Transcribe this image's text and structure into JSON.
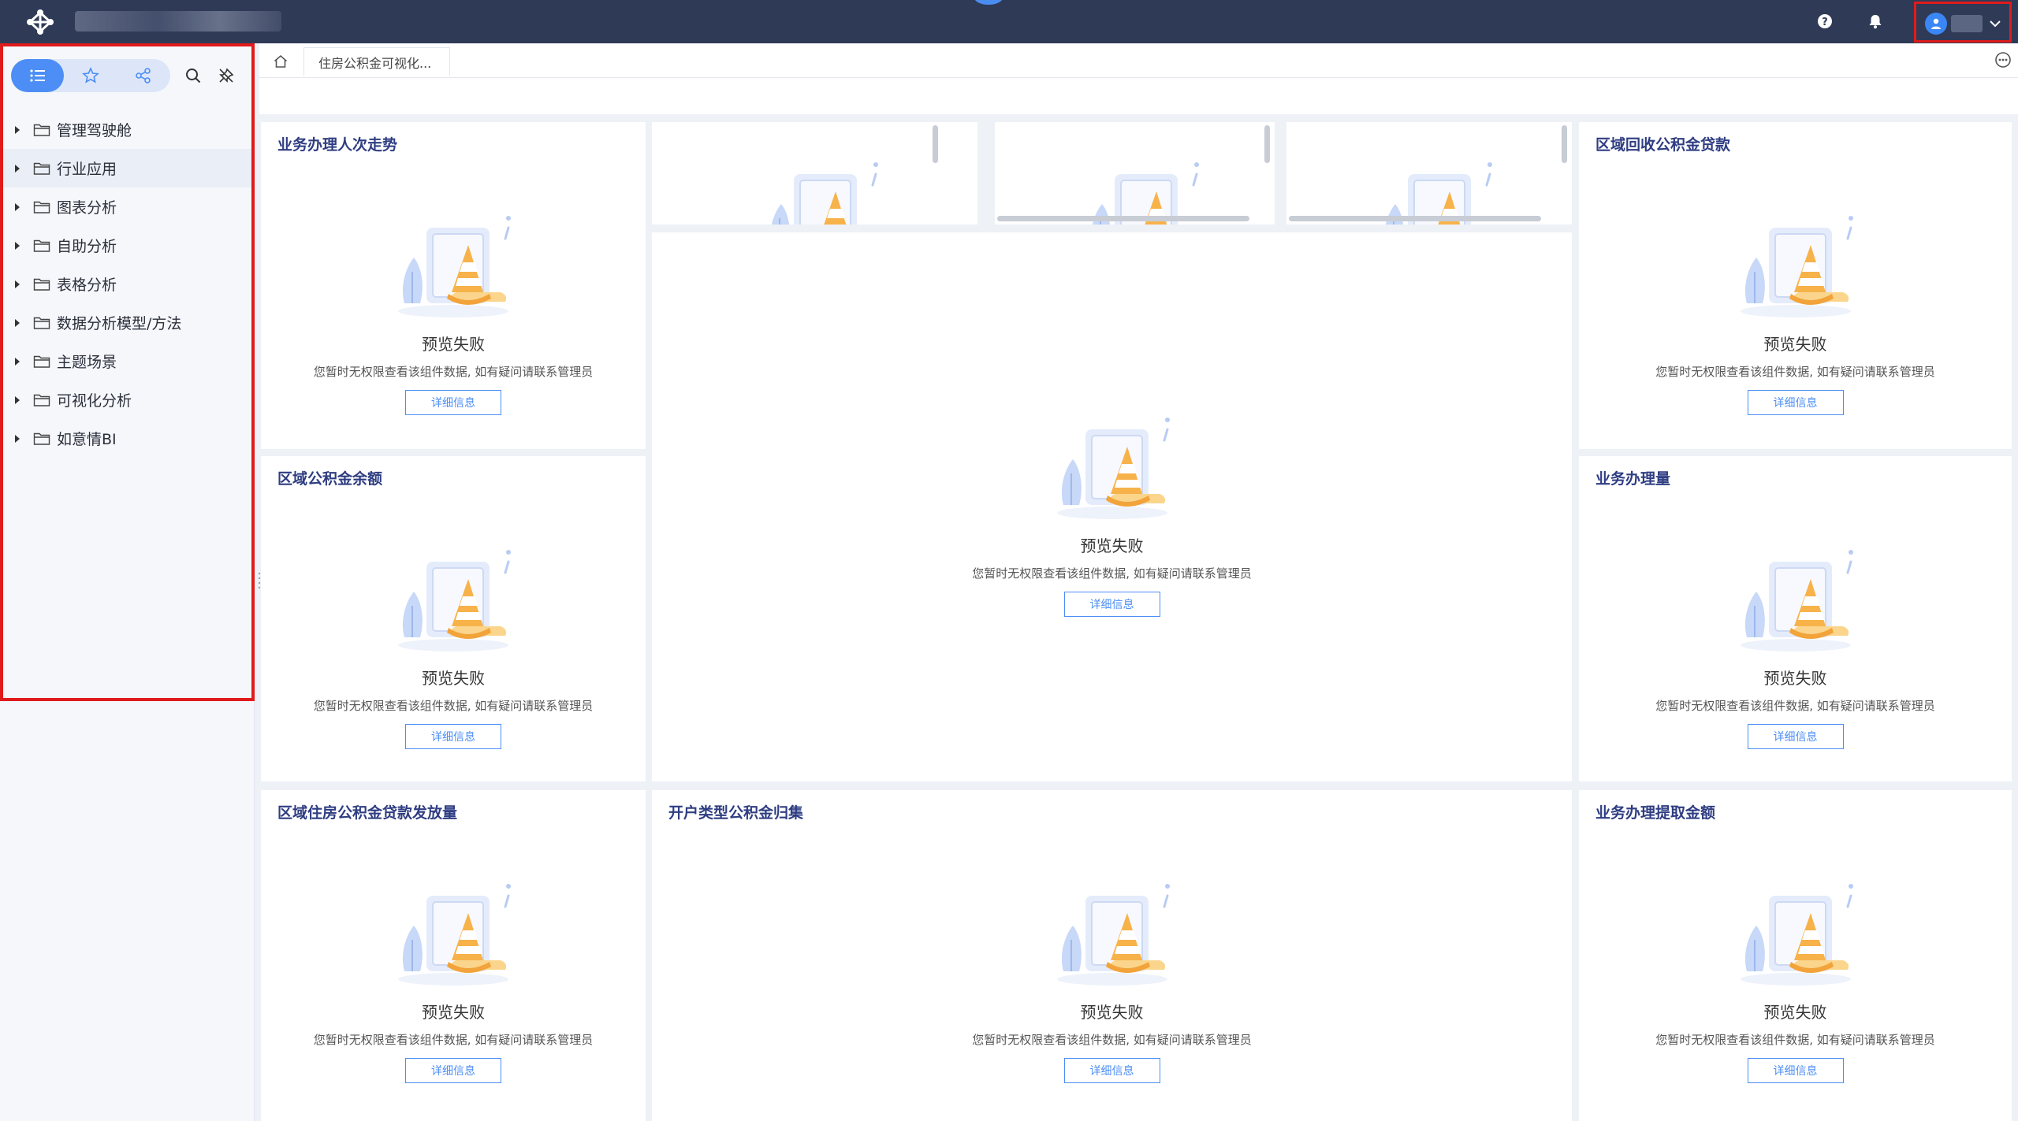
{
  "colors": {
    "topbar": "#2f3a57",
    "accent": "#4c8ef5",
    "highlight_frame": "#e01b1b",
    "card_title": "#2f3d82"
  },
  "header": {
    "icons": [
      "help-icon",
      "bell-icon",
      "user-avatar-icon",
      "chevron-down-icon"
    ]
  },
  "sidebar": {
    "toolbar_icons": [
      "list-icon",
      "star-icon",
      "share-icon",
      "search-icon",
      "pin-icon"
    ],
    "items": [
      {
        "label": "管理驾驶舱"
      },
      {
        "label": "行业应用"
      },
      {
        "label": "图表分析"
      },
      {
        "label": "自助分析"
      },
      {
        "label": "表格分析"
      },
      {
        "label": "数据分析模型/方法"
      },
      {
        "label": "主题场景"
      },
      {
        "label": "可视化分析"
      },
      {
        "label": "如意情BI"
      }
    ]
  },
  "tabs": {
    "current": "住房公积金可视化..."
  },
  "empty_state": {
    "title": "预览失败",
    "desc": "您暂时无权限查看该组件数据, 如有疑问请联系管理员",
    "button": "详细信息"
  },
  "cards": [
    {
      "title": "业务办理人次走势"
    },
    {
      "title": "区域回收公积金贷款"
    },
    {
      "title": "区域公积金余额"
    },
    {
      "title": "业务办理量"
    },
    {
      "title": "区域住房公积金贷款发放量"
    },
    {
      "title": "开户类型公积金归集"
    },
    {
      "title": "业务办理提取金额"
    }
  ]
}
